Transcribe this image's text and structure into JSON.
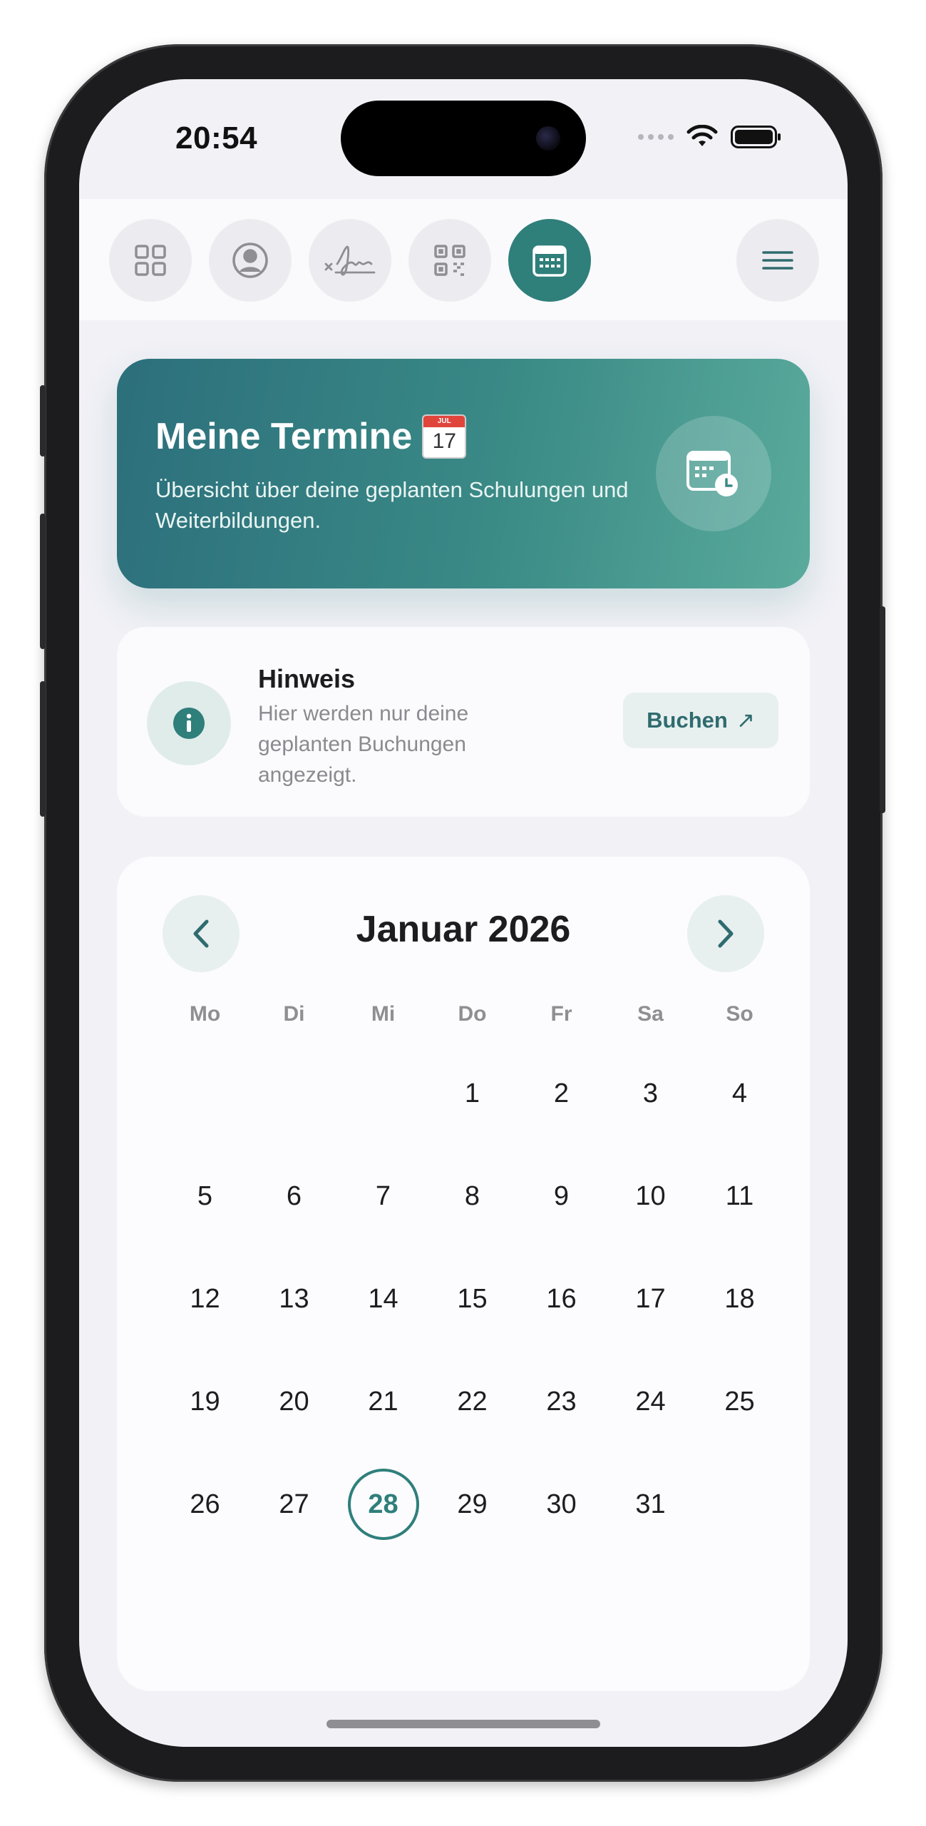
{
  "status_bar": {
    "time": "20:54"
  },
  "nav": {
    "items": [
      {
        "icon": "grid-icon",
        "active": false
      },
      {
        "icon": "profile-icon",
        "active": false
      },
      {
        "icon": "signature-icon",
        "active": false
      },
      {
        "icon": "qr-code-icon",
        "active": false
      },
      {
        "icon": "calendar-icon",
        "active": true
      }
    ],
    "menu_icon": "hamburger-menu-icon"
  },
  "hero": {
    "title": "Meine Termine",
    "emoji_month": "JUL",
    "emoji_day": "17",
    "subtitle": "Übersicht über deine geplanten Schulungen und Weiterbildungen."
  },
  "notice": {
    "title": "Hinweis",
    "text": "Hier werden nur deine geplanten Buchungen angezeigt.",
    "button_label": "Buchen",
    "button_arrow": "↗"
  },
  "calendar": {
    "title": "Januar 2026",
    "weekdays": [
      "Mo",
      "Di",
      "Mi",
      "Do",
      "Fr",
      "Sa",
      "So"
    ],
    "leading_blanks": 3,
    "days_in_month": 31,
    "today": 28
  },
  "colors": {
    "accent": "#2f7f7b",
    "hero_gradient_start": "#2c6f7c",
    "hero_gradient_end": "#5aab9c",
    "screen_background": "#f1f1f6"
  }
}
